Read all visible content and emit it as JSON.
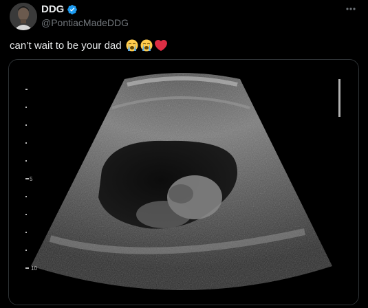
{
  "author": {
    "display_name": "DDG",
    "handle": "@PontiacMadeDDG",
    "verified": true
  },
  "tweet": {
    "text": "can’t wait to be your dad",
    "emojis": [
      "loudly-crying-face-emoji",
      "loudly-crying-face-emoji",
      "red-heart-emoji"
    ]
  },
  "media": {
    "type": "ultrasound image",
    "depth_labels": [
      "5",
      "10"
    ]
  },
  "colors": {
    "background": "#000000",
    "text": "#e7e9ea",
    "secondary": "#71767b",
    "verified": "#1d9bf0",
    "border": "#2f3336"
  }
}
